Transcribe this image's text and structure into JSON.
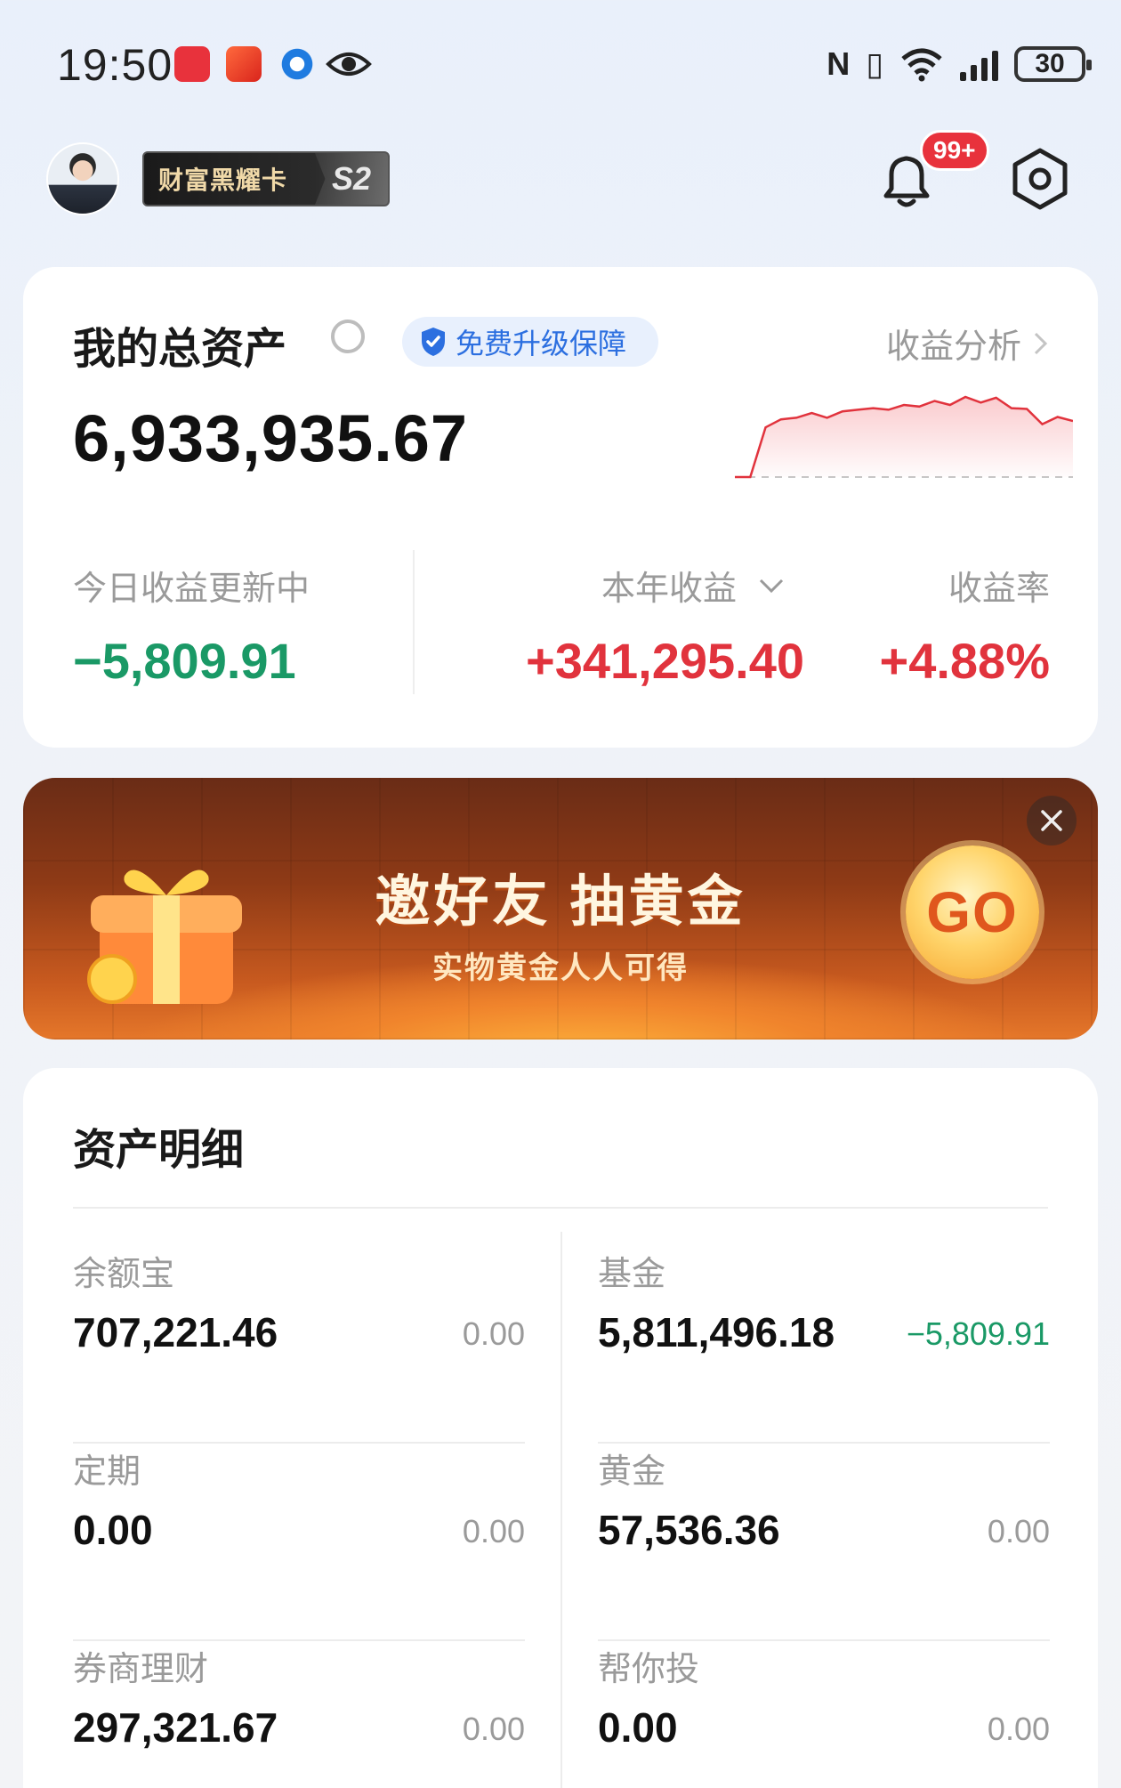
{
  "status_bar": {
    "time": "19:50",
    "app_icons": [
      "huawei-app-icon",
      "red-packet-app-icon",
      "blue-app-icon",
      "eye-app-icon"
    ],
    "battery": "30"
  },
  "header": {
    "vip_badge": "财富黑耀卡",
    "vip_level": "S2",
    "notification_count": "99+"
  },
  "assets": {
    "title": "我的总资产",
    "protection_label": "免费升级保障",
    "analysis_link": "收益分析",
    "total": "6,933,935.67",
    "today_label": "今日收益更新中",
    "today_value": "−5,809.91",
    "year_label": "本年收益",
    "year_value": "+341,295.40",
    "rate_label": "收益率",
    "rate_value": "+4.88%",
    "sparkline": [
      0,
      0,
      0.62,
      0.72,
      0.74,
      0.8,
      0.74,
      0.82,
      0.84,
      0.86,
      0.84,
      0.9,
      0.88,
      0.95,
      0.9,
      1.0,
      0.93,
      0.99,
      0.86,
      0.85,
      0.66,
      0.75,
      0.7
    ]
  },
  "banner": {
    "title": "邀好友 抽黄金",
    "subtitle": "实物黄金人人可得",
    "go_label": "GO"
  },
  "details": {
    "title": "资产明细",
    "items": [
      {
        "name": "余额宝",
        "amount": "707,221.46",
        "change": "0.00"
      },
      {
        "name": "基金",
        "amount": "5,811,496.18",
        "change": "−5,809.91"
      },
      {
        "name": "定期",
        "amount": "0.00",
        "change": "0.00"
      },
      {
        "name": "黄金",
        "amount": "57,536.36",
        "change": "0.00"
      },
      {
        "name": "券商理财",
        "amount": "297,321.67",
        "change": "0.00"
      },
      {
        "name": "帮你投",
        "amount": "0.00",
        "change": "0.00"
      }
    ]
  },
  "colors": {
    "gain": "#e1333d",
    "loss": "#1a9966",
    "accent": "#2c6fe0"
  }
}
